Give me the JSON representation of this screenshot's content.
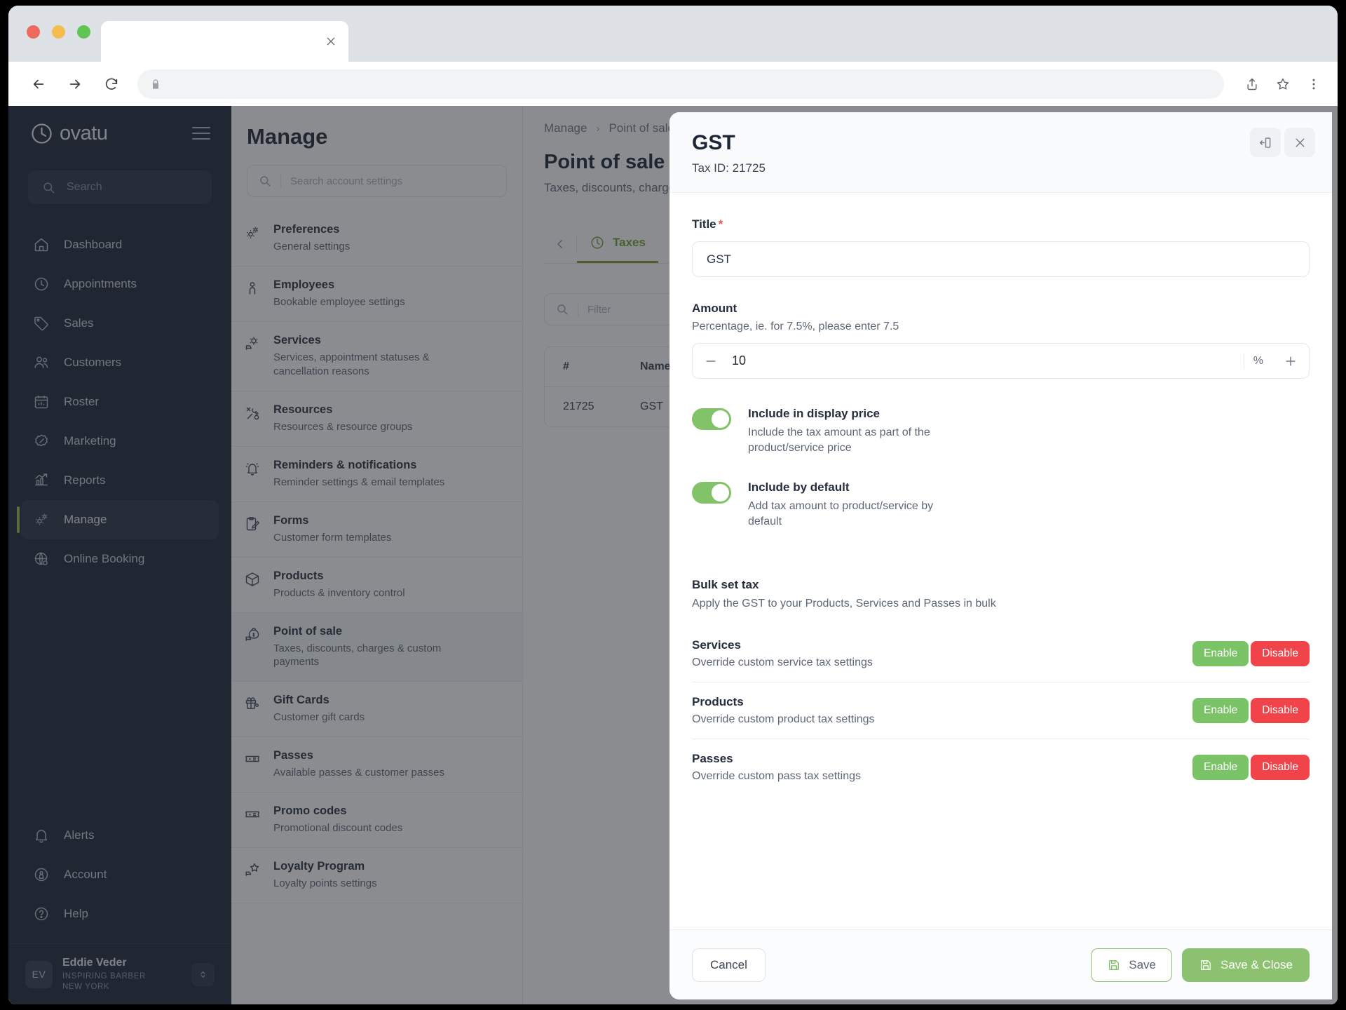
{
  "browser": {
    "tab_title": "",
    "url": "",
    "back_icon": "arrow-left-icon",
    "forward_icon": "arrow-right-icon",
    "reload_icon": "reload-icon",
    "lock_icon": "lock-icon",
    "share_icon": "share-icon",
    "bookmark_icon": "star-icon",
    "menu_icon": "kebab-menu-icon"
  },
  "sidebar": {
    "brand": "ovatu",
    "search_placeholder": "Search",
    "items": [
      {
        "label": "Dashboard",
        "icon": "home-icon",
        "active": false
      },
      {
        "label": "Appointments",
        "icon": "clock-icon",
        "active": false
      },
      {
        "label": "Sales",
        "icon": "tag-icon",
        "active": false
      },
      {
        "label": "Customers",
        "icon": "users-icon",
        "active": false
      },
      {
        "label": "Roster",
        "icon": "calendar-icon",
        "active": false
      },
      {
        "label": "Marketing",
        "icon": "megaphone-icon",
        "active": false
      },
      {
        "label": "Reports",
        "icon": "bar-chart-icon",
        "active": false
      },
      {
        "label": "Manage",
        "icon": "gears-icon",
        "active": true
      },
      {
        "label": "Online Booking",
        "icon": "globe-gear-icon",
        "active": false
      }
    ],
    "bottom_items": [
      {
        "label": "Alerts",
        "icon": "bell-icon"
      },
      {
        "label": "Account",
        "icon": "account-circle-icon"
      },
      {
        "label": "Help",
        "icon": "question-circle-icon"
      }
    ],
    "profile": {
      "initials": "EV",
      "name": "Eddie Veder",
      "org": "INSPIRING BARBER NEW YORK",
      "switch_icon": "chevron-updown-icon"
    }
  },
  "settings_panel": {
    "title": "Manage",
    "search_placeholder": "Search account settings",
    "items": [
      {
        "name": "Preferences",
        "desc": "General settings",
        "icon": "gears-icon",
        "selected": false
      },
      {
        "name": "Employees",
        "desc": "Bookable employee settings",
        "icon": "person-icon",
        "selected": false
      },
      {
        "name": "Services",
        "desc": "Services, appointment statuses & cancellation reasons",
        "icon": "service-gear-icon",
        "selected": false
      },
      {
        "name": "Resources",
        "desc": "Resources & resource groups",
        "icon": "tools-icon",
        "selected": false
      },
      {
        "name": "Reminders & notifications",
        "desc": "Reminder settings & email templates",
        "icon": "alarm-bell-icon",
        "selected": false
      },
      {
        "name": "Forms",
        "desc": "Customer form templates",
        "icon": "clipboard-pen-icon",
        "selected": false
      },
      {
        "name": "Products",
        "desc": "Products & inventory control",
        "icon": "box-icon",
        "selected": false
      },
      {
        "name": "Point of sale",
        "desc": "Taxes, discounts, charges & custom payments",
        "icon": "money-bag-icon",
        "selected": true
      },
      {
        "name": "Gift Cards",
        "desc": "Customer gift cards",
        "icon": "gift-icon",
        "selected": false
      },
      {
        "name": "Passes",
        "desc": "Available passes & customer passes",
        "icon": "ticket-icon",
        "selected": false
      },
      {
        "name": "Promo codes",
        "desc": "Promotional discount codes",
        "icon": "ticket-icon",
        "selected": false
      },
      {
        "name": "Loyalty Program",
        "desc": "Loyalty points settings",
        "icon": "star-flag-icon",
        "selected": false
      }
    ]
  },
  "main": {
    "breadcrumb": [
      "Manage",
      "Point of sale"
    ],
    "breadcrumb_sep": "›",
    "title": "Point of sale",
    "subtitle": "Taxes, discounts, charges & custom payments",
    "prev_icon": "chevron-left-icon",
    "tabs": [
      {
        "label": "Taxes",
        "icon": "clock-icon",
        "active": true
      }
    ],
    "filter_placeholder": "Filter",
    "table": {
      "headers": [
        "#",
        "Name"
      ],
      "rows": [
        {
          "id": "21725",
          "name": "GST"
        }
      ]
    }
  },
  "modal": {
    "title": "GST",
    "subtitle": "Tax ID: 21725",
    "collapse_icon": "collapse-panel-icon",
    "close_icon": "close-icon",
    "title_field": {
      "label": "Title",
      "required_marker": "*",
      "value": "GST"
    },
    "amount_field": {
      "label": "Amount",
      "help": "Percentage, ie. for 7.5%, please enter 7.5",
      "value": "10",
      "unit": "%",
      "minus_icon": "minus-icon",
      "plus_icon": "plus-icon"
    },
    "toggles": [
      {
        "name": "Include in display price",
        "desc": "Include the tax amount as part of the product/service price",
        "on": true
      },
      {
        "name": "Include by default",
        "desc": "Add tax amount to product/service by default",
        "on": true
      }
    ],
    "bulk": {
      "title": "Bulk set tax",
      "desc": "Apply the GST to your Products, Services and Passes in bulk",
      "enable_label": "Enable",
      "disable_label": "Disable",
      "rows": [
        {
          "name": "Services",
          "desc": "Override custom service tax settings"
        },
        {
          "name": "Products",
          "desc": "Override custom product tax settings"
        },
        {
          "name": "Passes",
          "desc": "Override custom pass tax settings"
        }
      ]
    },
    "footer": {
      "cancel_label": "Cancel",
      "save_label": "Save",
      "save_close_label": "Save & Close",
      "save_icon": "floppy-disk-icon"
    }
  },
  "colors": {
    "brand_green": "#8cc26f",
    "accent_green": "#7bc367",
    "danger_red": "#f1444a",
    "sidebar_bg": "#161f2f",
    "active_tab_green": "#6f9c2b"
  }
}
